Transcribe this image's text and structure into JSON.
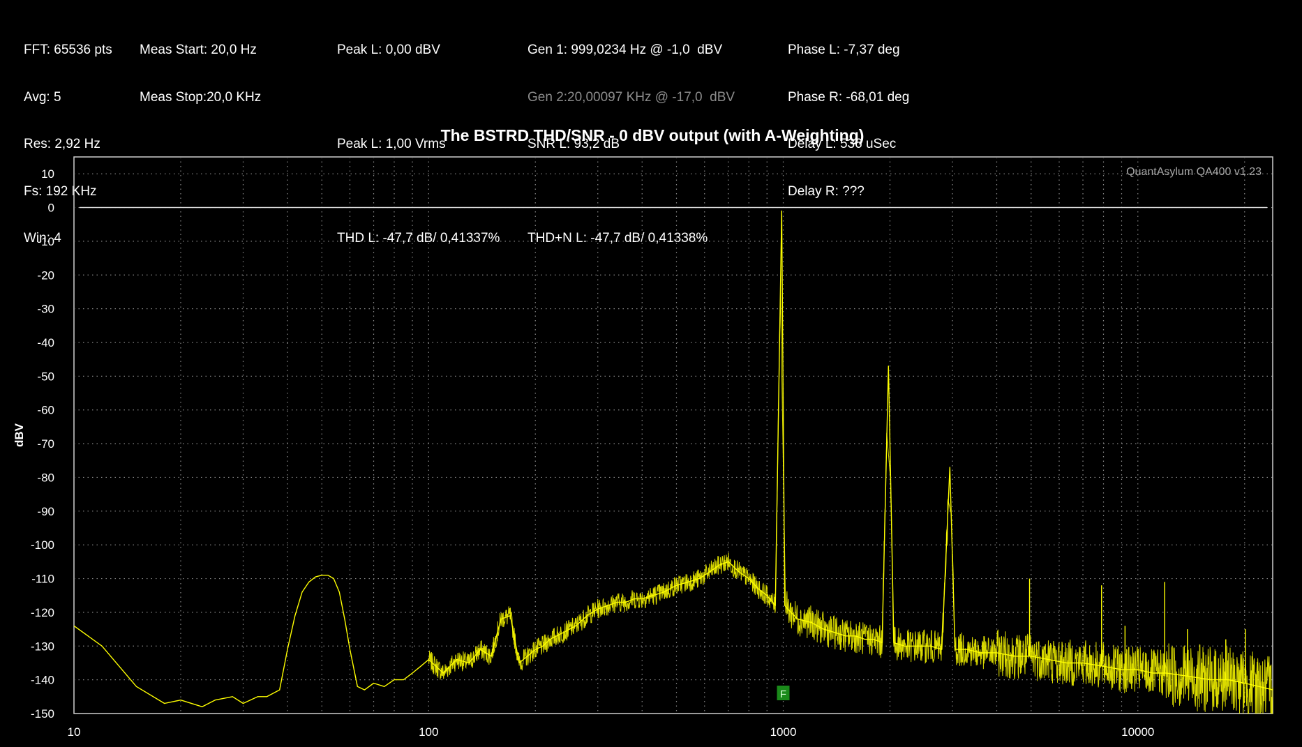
{
  "info": {
    "col1": [
      "FFT: 65536 pts",
      "Avg: 5",
      "Res: 2,92 Hz",
      "Fs: 192 KHz",
      "Win: 4"
    ],
    "col2": [
      "Meas Start: 20,0 Hz",
      "Meas Stop:20,0 KHz"
    ],
    "col3": [
      "Peak L: 0,00 dBV",
      "",
      "Peak L: 1,00 Vrms",
      "",
      "THD L: -47,7 dB/ 0,41337%"
    ],
    "col4": [
      "Gen 1: 999,0234 Hz @ -1,0  dBV",
      "Gen 2:20,00097 KHz @ -17,0  dBV",
      "SNR L: 93,2 dB",
      "",
      "THD+N L: -47,7 dB/ 0,41338%"
    ],
    "col5": [
      "Phase L: -7,37 deg",
      "Phase R: -68,01 deg",
      "Delay L: 536 uSec",
      "Delay R: ???"
    ]
  },
  "chart_data": {
    "type": "line",
    "title": "The BSTRD THD/SNR - 0 dBV output (with A-Weighting)",
    "ylabel": "dBV",
    "xlabel": "",
    "watermark": "QuantAsylum QA400 v1.23",
    "x_scale": "log",
    "xlim": [
      10,
      24000
    ],
    "ylim": [
      -150,
      15
    ],
    "x_ticks": [
      10,
      100,
      1000,
      10000
    ],
    "x_tick_labels": [
      "10",
      "100",
      "1000",
      "10000"
    ],
    "y_ticks": [
      10,
      0,
      -10,
      -20,
      -30,
      -40,
      -50,
      -60,
      -70,
      -80,
      -90,
      -100,
      -110,
      -120,
      -130,
      -140,
      -150
    ],
    "grid": true,
    "reference_line_y": 0,
    "marker": {
      "label": "F",
      "x": 1000,
      "color": "#1a8a1a"
    },
    "series": [
      {
        "color": "#ffff00",
        "x": [
          10,
          12,
          15,
          18,
          20,
          23,
          25,
          28,
          30,
          33,
          35,
          38,
          40,
          42,
          44,
          46,
          48,
          50,
          52,
          54,
          56,
          58,
          60,
          63,
          66,
          70,
          75,
          80,
          85,
          90,
          95,
          100,
          110,
          120,
          130,
          140,
          150,
          160,
          170,
          180,
          190,
          200,
          210,
          220,
          240,
          260,
          280,
          300,
          320,
          340,
          360,
          380,
          400,
          430,
          460,
          500,
          540,
          580,
          620,
          660,
          700,
          750,
          800,
          850,
          900,
          950,
          990,
          1010,
          1050,
          1100,
          1200,
          1300,
          1400,
          1500,
          1600,
          1700,
          1800,
          1900,
          1980,
          2050,
          2200,
          2400,
          2600,
          2800,
          2950,
          3050,
          3300,
          3600,
          4000,
          4500,
          5000,
          5600,
          6300,
          7000,
          8000,
          9000,
          10000,
          11000,
          12000,
          14000,
          16000,
          18000,
          20000,
          22000,
          24000
        ],
        "y": [
          -124,
          -130,
          -142,
          -147,
          -146,
          -148,
          -146,
          -145,
          -147,
          -145,
          -145,
          -143,
          -131,
          -121,
          -114,
          -111,
          -109.5,
          -109,
          -109,
          -110,
          -114,
          -122,
          -131,
          -142,
          -143,
          -141,
          -142,
          -140,
          -140,
          -138,
          -136,
          -134,
          -138,
          -134,
          -135,
          -131,
          -133,
          -122,
          -121,
          -135,
          -133,
          -131,
          -130,
          -128,
          -126,
          -124,
          -121,
          -119,
          -118,
          -117,
          -117,
          -116,
          -116,
          -115,
          -114,
          -112,
          -111,
          -110,
          -108,
          -106,
          -105,
          -108,
          -110,
          -113,
          -115,
          -118,
          -1,
          -118,
          -120,
          -122,
          -123,
          -125,
          -126,
          -127,
          -127,
          -128,
          -128,
          -129,
          -47,
          -129,
          -130,
          -130,
          -130,
          -131,
          -77,
          -131,
          -131,
          -132,
          -132,
          -133,
          -133,
          -134,
          -135,
          -135,
          -136,
          -137,
          -137,
          -138,
          -138,
          -139,
          -140,
          -140,
          -141,
          -142,
          -143
        ]
      }
    ]
  }
}
